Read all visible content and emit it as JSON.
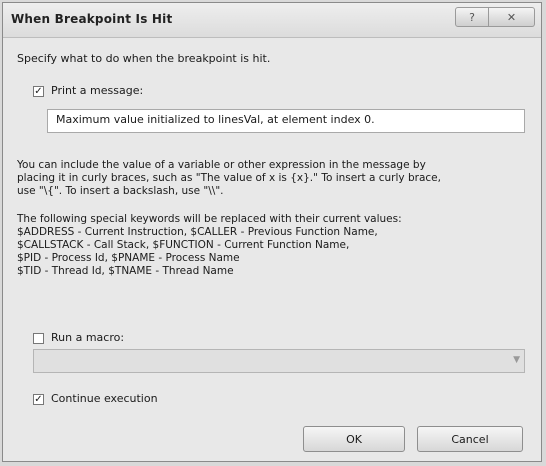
{
  "window": {
    "title": "When Breakpoint Is Hit"
  },
  "window_buttons": {
    "help": "?",
    "close": "✕"
  },
  "instruction": "Specify what to do when the breakpoint is hit.",
  "print_message": {
    "checked": true,
    "label": "Print a message:",
    "value": "Maximum value initialized to linesVal, at element index 0."
  },
  "help_text": {
    "line1": "You can include the value of a variable or other expression in the message by",
    "line2": "placing it in curly braces, such as \"The value of x is {x}.\" To insert a curly brace,",
    "line3": "use \"\\{\". To insert a backslash, use \"\\\\\"."
  },
  "keywords": {
    "line1": "The following special keywords will be replaced with their current values:",
    "line2": "$ADDRESS - Current Instruction, $CALLER - Previous Function Name,",
    "line3": "$CALLSTACK - Call Stack, $FUNCTION - Current Function Name,",
    "line4": "$PID - Process Id, $PNAME - Process Name",
    "line5": "$TID - Thread Id, $TNAME - Thread Name"
  },
  "run_macro": {
    "checked": false,
    "label": "Run a macro:",
    "value": ""
  },
  "continue_execution": {
    "checked": true,
    "label": "Continue execution"
  },
  "buttons": {
    "ok": "OK",
    "cancel": "Cancel"
  }
}
